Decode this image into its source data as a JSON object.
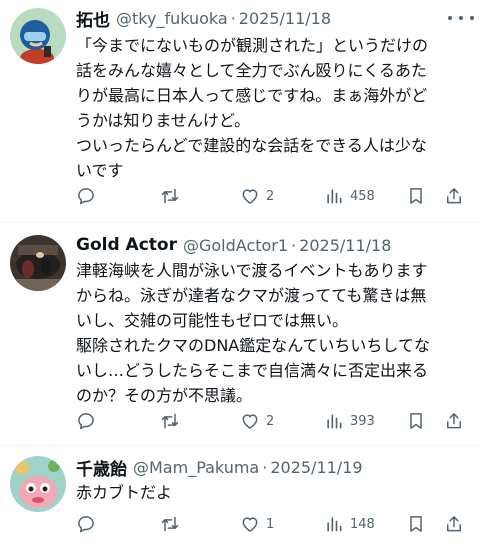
{
  "posts": [
    {
      "name": "拓也",
      "handle": "@tky_fukuoka",
      "date": "2025/11/18",
      "lines": [
        "「今までにないものが観測された」というだけの",
        "話をみんな嬉々として全力でぶん殴りにくるあた",
        "りが最高に日本人って感じですね。まぁ海外がど",
        "うかは知りませんけど。",
        "ついったらんどで建設的な会話をできる人は少な",
        "いです"
      ],
      "likes": "2",
      "views": "458"
    },
    {
      "name": "Gold Actor",
      "handle": "@GoldActor1",
      "date": "2025/11/18",
      "lines": [
        "津軽海峡を人間が泳いで渡るイベントもあります",
        "からね。泳ぎが達者なクマが渡ってても驚きは無",
        "いし、交雑の可能性もゼロでは無い。",
        "駆除されたクマのDNA鑑定なんていちいちしてな",
        "いし…どうしたらそこまで自信満々に否定出来る",
        "のか？その方が不思議。"
      ],
      "likes": "2",
      "views": "393"
    },
    {
      "name": "千歳飴",
      "handle": "@Mam_Pakuma",
      "date": "2025/11/19",
      "lines": [
        "赤カブトだよ"
      ],
      "likes": "1",
      "views": "148"
    }
  ],
  "separator": "·",
  "colors": {
    "text": "#0f1419",
    "secondary": "#536471",
    "divider": "#eff3f4"
  }
}
